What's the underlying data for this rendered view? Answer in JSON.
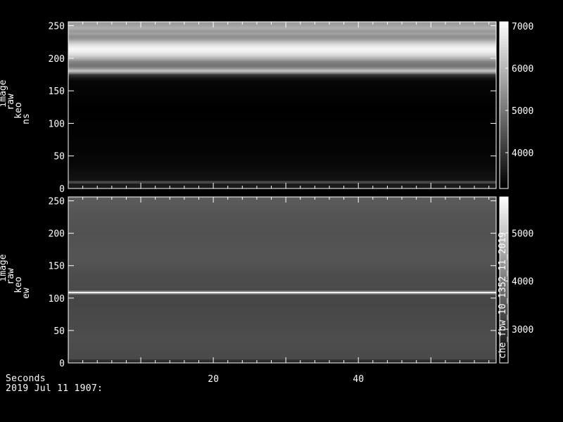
{
  "colors": {
    "background": "#000000",
    "foreground": "#ffffff"
  },
  "footer": {
    "x_axis_title": "Seconds",
    "date_label": "2019 Jul 11 1907:"
  },
  "chart_data": [
    {
      "type": "heatmap",
      "ylabel_lines": [
        "image",
        "raw",
        "keo",
        "ns"
      ],
      "xlim": [
        0,
        59
      ],
      "ylim": [
        0,
        256
      ],
      "yticks": [
        0,
        50,
        100,
        150,
        200,
        250
      ],
      "xticks": [
        20,
        40
      ],
      "colorbar": {
        "range": [
          3150,
          7100
        ],
        "ticks": [
          4000,
          5000,
          6000,
          7000
        ]
      },
      "intensity_profile": [
        [
          0,
          3550
        ],
        [
          7,
          3550
        ],
        [
          8,
          4250
        ],
        [
          12,
          4250
        ],
        [
          13,
          3450
        ],
        [
          40,
          3250
        ],
        [
          120,
          3150
        ],
        [
          165,
          3250
        ],
        [
          170,
          3500
        ],
        [
          175,
          4000
        ],
        [
          178,
          5400
        ],
        [
          181,
          6200
        ],
        [
          184,
          5600
        ],
        [
          188,
          4900
        ],
        [
          195,
          5200
        ],
        [
          200,
          5900
        ],
        [
          205,
          6500
        ],
        [
          210,
          6850
        ],
        [
          215,
          6950
        ],
        [
          220,
          6700
        ],
        [
          225,
          6200
        ],
        [
          230,
          5500
        ],
        [
          234,
          5300
        ],
        [
          238,
          5700
        ],
        [
          242,
          5450
        ],
        [
          246,
          5900
        ],
        [
          250,
          5700
        ],
        [
          256,
          5500
        ]
      ]
    },
    {
      "type": "heatmap",
      "ylabel_lines": [
        "image",
        "raw",
        "keo",
        "ew"
      ],
      "xlim": [
        0,
        59
      ],
      "ylim": [
        0,
        256
      ],
      "yticks": [
        0,
        50,
        100,
        150,
        200,
        250
      ],
      "xticks": [
        20,
        40
      ],
      "colorbar": {
        "range": [
          2300,
          5750
        ],
        "ticks": [
          3000,
          4000,
          5000
        ],
        "annotation": "che_fbw_10_1352_11_2019"
      },
      "intensity_profile": [
        [
          0,
          2700
        ],
        [
          5,
          3000
        ],
        [
          6,
          3300
        ],
        [
          40,
          3350
        ],
        [
          60,
          3300
        ],
        [
          100,
          3250
        ],
        [
          106,
          3300
        ],
        [
          108,
          4800
        ],
        [
          109,
          5700
        ],
        [
          110,
          4800
        ],
        [
          112,
          3300
        ],
        [
          140,
          3350
        ],
        [
          160,
          3450
        ],
        [
          200,
          3400
        ],
        [
          230,
          3450
        ],
        [
          256,
          3550
        ]
      ]
    }
  ]
}
